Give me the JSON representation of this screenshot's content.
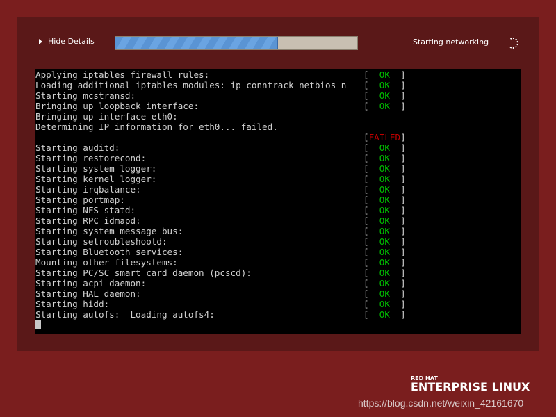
{
  "header": {
    "toggle_label": "Hide Details",
    "progress_percent": 67,
    "status_text": "Starting networking"
  },
  "terminal": {
    "lines": [
      {
        "text": "Applying iptables firewall rules:",
        "status": "OK"
      },
      {
        "text": "Loading additional iptables modules: ip_conntrack_netbios_n",
        "status": "OK"
      },
      {
        "text": "Starting mcstransd:",
        "status": "OK"
      },
      {
        "text": "Bringing up loopback interface:",
        "status": "OK"
      },
      {
        "text": "Bringing up interface eth0:",
        "status": ""
      },
      {
        "text": "Determining IP information for eth0... failed.",
        "status": ""
      },
      {
        "text": "",
        "status": "FAILED"
      },
      {
        "text": "Starting auditd:",
        "status": "OK"
      },
      {
        "text": "Starting restorecond:",
        "status": "OK"
      },
      {
        "text": "Starting system logger:",
        "status": "OK"
      },
      {
        "text": "Starting kernel logger:",
        "status": "OK"
      },
      {
        "text": "Starting irqbalance:",
        "status": "OK"
      },
      {
        "text": "Starting portmap:",
        "status": "OK"
      },
      {
        "text": "Starting NFS statd:",
        "status": "OK"
      },
      {
        "text": "Starting RPC idmapd:",
        "status": "OK"
      },
      {
        "text": "Starting system message bus:",
        "status": "OK"
      },
      {
        "text": "Starting setroubleshootd:",
        "status": "OK"
      },
      {
        "text": "Starting Bluetooth services:",
        "status": "OK"
      },
      {
        "text": "Mounting other filesystems:",
        "status": "OK"
      },
      {
        "text": "Starting PC/SC smart card daemon (pcscd):",
        "status": "OK"
      },
      {
        "text": "Starting acpi daemon:",
        "status": "OK"
      },
      {
        "text": "Starting HAL daemon:",
        "status": "OK"
      },
      {
        "text": "Starting hidd:",
        "status": "OK"
      },
      {
        "text": "Starting autofs:  Loading autofs4:",
        "status": "OK"
      }
    ]
  },
  "logo": {
    "line1": "RED HAT",
    "line2": "ENTERPRISE LINUX"
  },
  "watermark": "https://blog.csdn.net/weixin_42161670",
  "colors": {
    "ok": "#00c000",
    "failed": "#c00000",
    "background": "#7a1e1e",
    "panel": "#5a1818"
  }
}
